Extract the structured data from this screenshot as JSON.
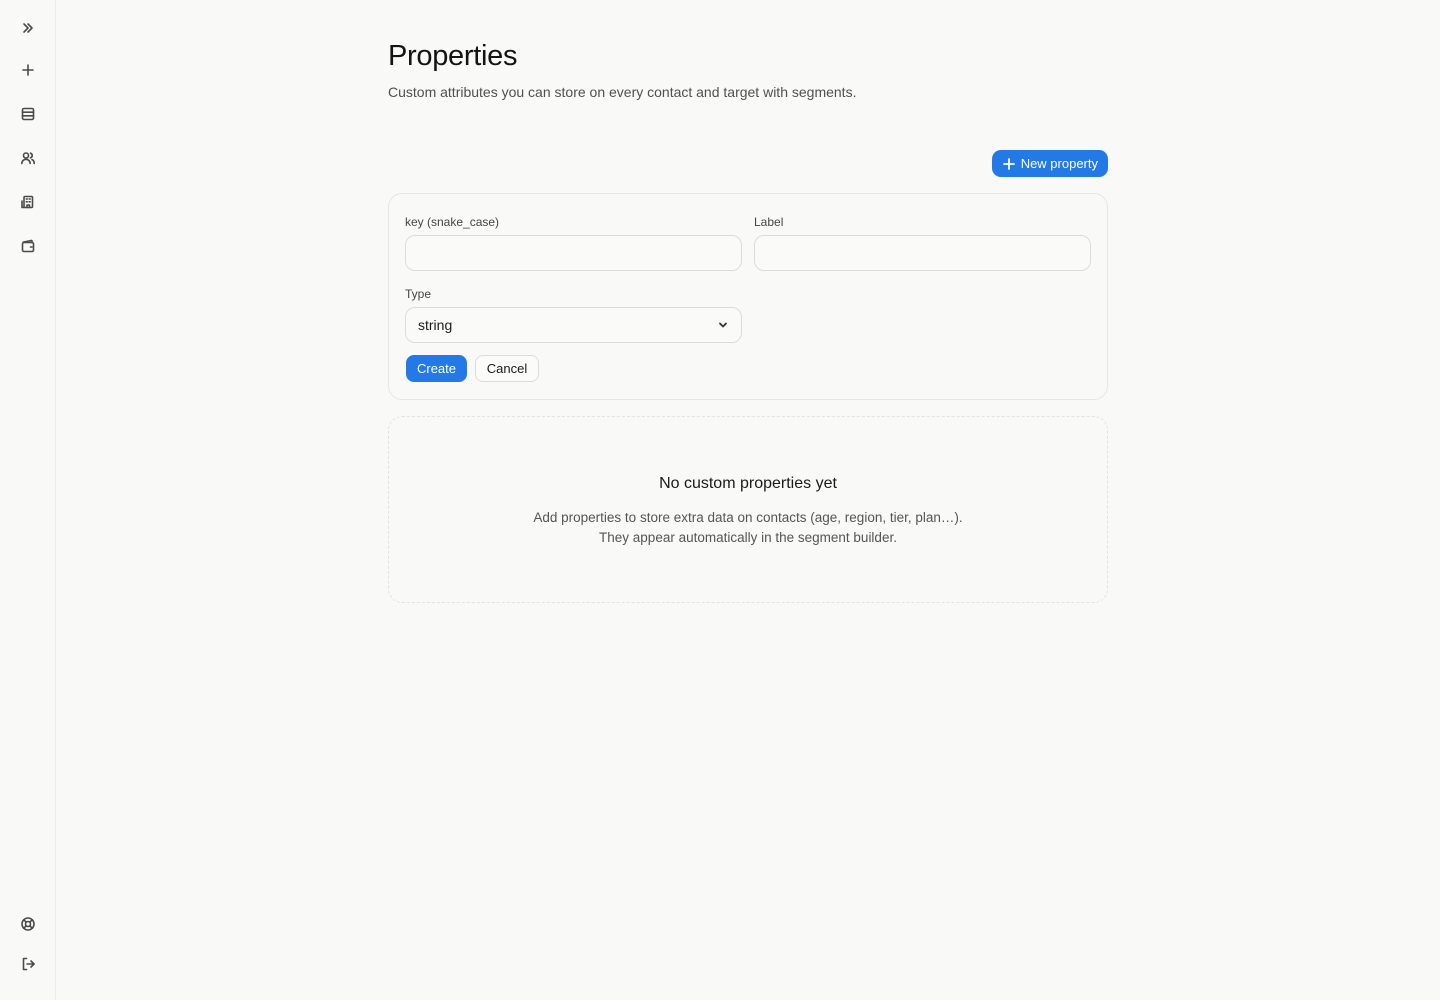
{
  "sidebar": {
    "top_items": [
      {
        "icon": "chevrons-right-icon",
        "name": "sidebar-expand-button"
      },
      {
        "icon": "plus-icon",
        "name": "sidebar-new-button"
      },
      {
        "icon": "list-icon",
        "name": "sidebar-item-lists"
      },
      {
        "icon": "users-icon",
        "name": "sidebar-item-contacts"
      },
      {
        "icon": "building-icon",
        "name": "sidebar-item-organization"
      },
      {
        "icon": "wallet-icon",
        "name": "sidebar-item-billing"
      }
    ],
    "bottom_items": [
      {
        "icon": "lifebuoy-icon",
        "name": "sidebar-item-help"
      },
      {
        "icon": "logout-icon",
        "name": "sidebar-item-logout"
      }
    ]
  },
  "page": {
    "title": "Properties",
    "subtitle": "Custom attributes you can store on every contact and target with segments."
  },
  "toolbar": {
    "new_property_label": "New property"
  },
  "form": {
    "key_label": "key (snake_case)",
    "key_value": "",
    "label_label": "Label",
    "label_value": "",
    "type_label": "Type",
    "type_value": "string",
    "create_label": "Create",
    "cancel_label": "Cancel"
  },
  "empty_state": {
    "title": "No custom properties yet",
    "line1": "Add properties to store extra data on contacts (age, region, tier, plan…).",
    "line2": "They appear automatically in the segment builder."
  },
  "colors": {
    "accent": "#2379e6",
    "background": "#f9f9f8"
  }
}
